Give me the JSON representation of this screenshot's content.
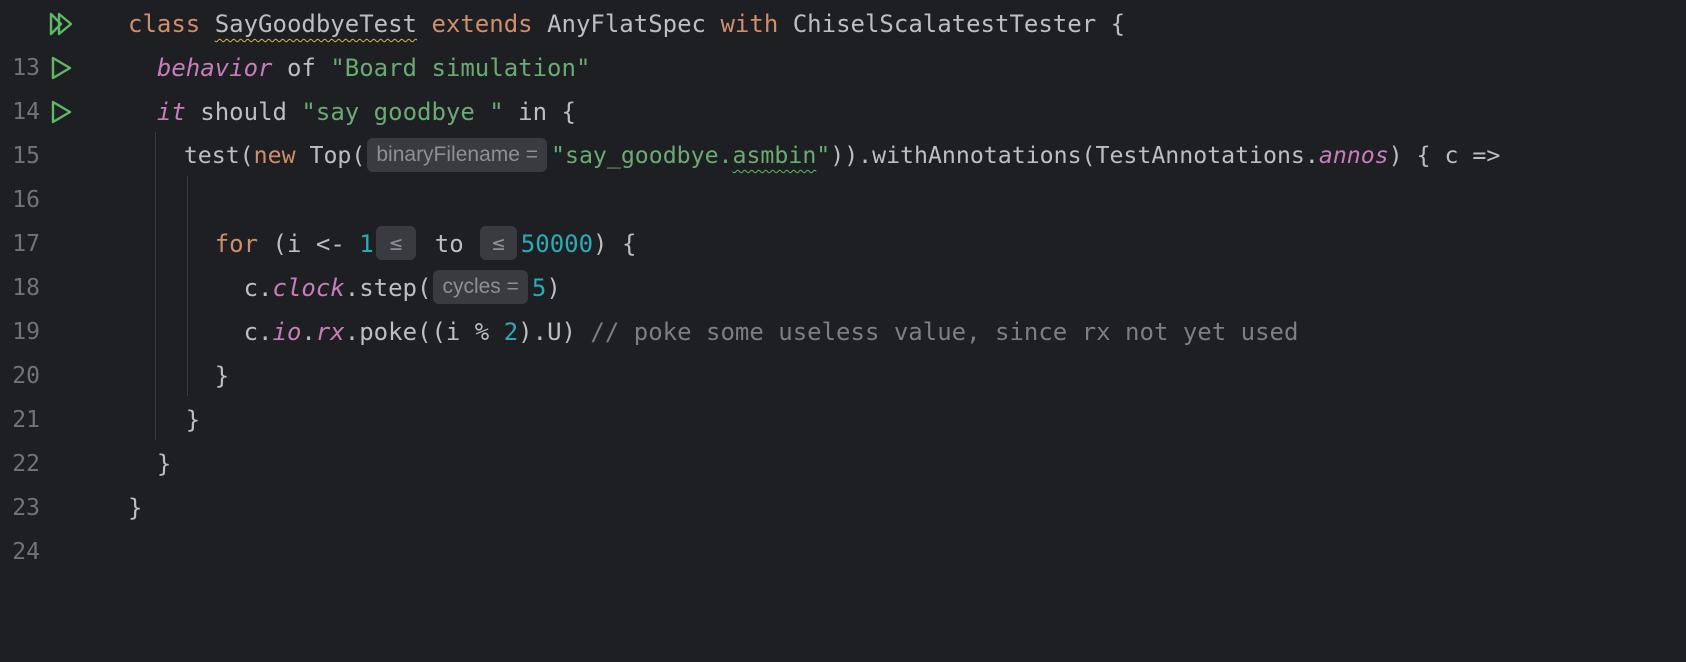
{
  "editor": {
    "lines": [
      {
        "num": "13",
        "run_icon": "run-all-icon"
      },
      {
        "num": "14",
        "run_icon": "run-icon"
      },
      {
        "num": "15",
        "run_icon": "run-icon"
      },
      {
        "num": "16"
      },
      {
        "num": "17"
      },
      {
        "num": "18"
      },
      {
        "num": "19"
      },
      {
        "num": "20"
      },
      {
        "num": "21"
      },
      {
        "num": "22"
      },
      {
        "num": "23"
      },
      {
        "num": "24"
      }
    ],
    "tokens": {
      "l13": {
        "class_kw": "class",
        "class_name": "SayGoodbyeTest",
        "extends_kw": "extends",
        "base": "AnyFlatSpec",
        "with_kw": "with",
        "mixin": "ChiselScalatestTester",
        "brace": "{"
      },
      "l14": {
        "behavior": "behavior",
        "of": "of",
        "str": "\"Board simulation\""
      },
      "l15": {
        "it": "it",
        "should": "should",
        "str": "\"say goodbye \"",
        "in": "in {"
      },
      "l16": {
        "test": "test(",
        "new_kw": "new",
        "top": "Top(",
        "hint": "binaryFilename =",
        "str_a": "\"say_goodbye.",
        "str_b": "asmbin",
        "str_c": "\"",
        "rest_a": ")).withAnnotations(TestAnnotations.",
        "annos": "annos",
        "rest_b": ") { c =>"
      },
      "l18": {
        "for_kw": "for",
        "open": "(i <-",
        "from": "1",
        "hint_a": "≤",
        "to": "to",
        "hint_b": "≤",
        "until": "50000",
        "close": ") {"
      },
      "l19": {
        "c": "c.",
        "clock": "clock",
        "step": ".step(",
        "hint": "cycles =",
        "val": "5",
        "close": ")"
      },
      "l20": {
        "c": "c.",
        "io": "io",
        "dot": ".",
        "rx": "rx",
        "poke": ".poke((i %",
        "two": "2",
        "u": ").U)",
        "comment": "// poke some useless value, since rx not yet used"
      },
      "l21": {
        "brace": "}"
      },
      "l22": {
        "brace": "}"
      },
      "l23": {
        "brace": "}"
      },
      "l24": {
        "brace": "}"
      }
    }
  },
  "colors": {
    "background": "#1e1f22",
    "keyword": "#cf8e6d",
    "string": "#6aab73",
    "number": "#2aacb8",
    "member": "#c77dbb",
    "comment": "#7a7e85",
    "run_icon": "#5fb865"
  }
}
